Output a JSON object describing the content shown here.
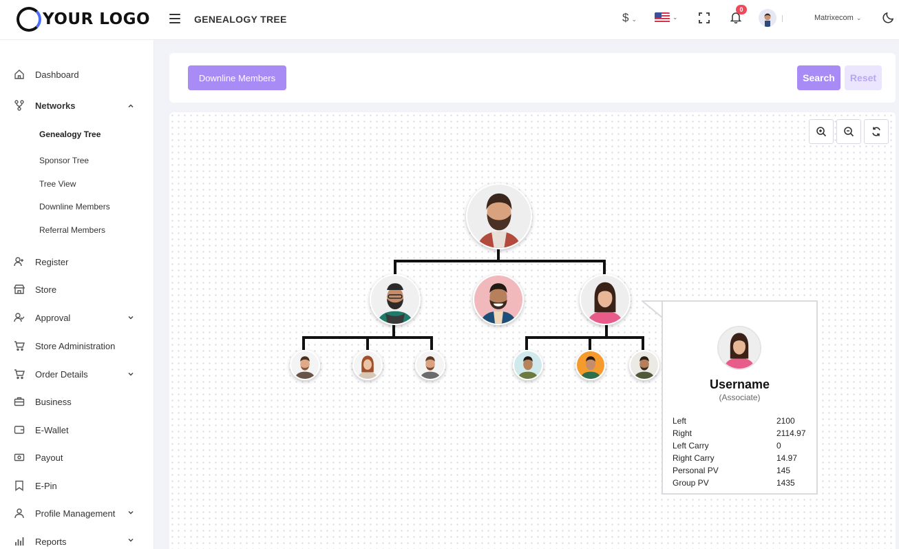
{
  "header": {
    "logo_text": "YOUR LOGO",
    "page_title": "GENEALOGY TREE",
    "currency_symbol": "$",
    "notification_count": "0",
    "user_name": "Matrixecom"
  },
  "sidebar": {
    "items": [
      {
        "label": "Dashboard",
        "icon": "home-icon"
      },
      {
        "label": "Networks",
        "icon": "network-icon"
      },
      {
        "label": "Register",
        "icon": "user-plus-icon"
      },
      {
        "label": "Store",
        "icon": "store-icon"
      },
      {
        "label": "Approval",
        "icon": "user-check-icon"
      },
      {
        "label": "Store Administration",
        "icon": "cart-icon"
      },
      {
        "label": "Order Details",
        "icon": "cart-icon"
      },
      {
        "label": "Business",
        "icon": "briefcase-icon"
      },
      {
        "label": "E-Wallet",
        "icon": "wallet-icon"
      },
      {
        "label": "Payout",
        "icon": "cash-icon"
      },
      {
        "label": "E-Pin",
        "icon": "bookmark-icon"
      },
      {
        "label": "Profile Management",
        "icon": "user-icon"
      },
      {
        "label": "Reports",
        "icon": "chart-icon"
      }
    ],
    "network_sub": [
      "Genealogy Tree",
      "Sponsor Tree",
      "Tree View",
      "Downline Members",
      "Referral Members"
    ]
  },
  "filter": {
    "downline_label": "Downline Members",
    "search_label": "Search",
    "reset_label": "Reset"
  },
  "popup": {
    "name": "Username",
    "role": "(Associate)",
    "stats": [
      {
        "label": "Left",
        "value": "2100"
      },
      {
        "label": "Right",
        "value": "2114.97"
      },
      {
        "label": "Left Carry",
        "value": "0"
      },
      {
        "label": "Right Carry",
        "value": "14.97"
      },
      {
        "label": "Personal PV",
        "value": "145"
      },
      {
        "label": "Group PV",
        "value": "1435"
      }
    ]
  },
  "colors": {
    "accent": "#a88bf5",
    "accent_light": "#ebe5fd",
    "badge": "#ef4a5c"
  }
}
